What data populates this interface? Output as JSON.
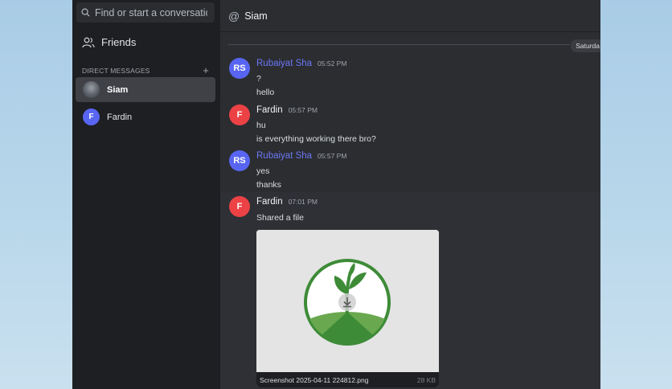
{
  "sidebar": {
    "search_placeholder": "Find or start a conversatic",
    "friends_label": "Friends",
    "dm_header": "DIRECT MESSAGES",
    "dm_add": "+",
    "dms": [
      {
        "name": "Siam",
        "avatar": "photo",
        "active": true
      },
      {
        "name": "Fardin",
        "avatar_initial": "F",
        "active": false
      }
    ]
  },
  "header": {
    "at_symbol": "@",
    "channel_name": "Siam"
  },
  "divider": {
    "label": "Saturda"
  },
  "messages": [
    {
      "initials": "RS",
      "author": "Rubaiyat Sha",
      "time": "05:52 PM",
      "lines": [
        "?",
        "hello"
      ]
    },
    {
      "initials": "F",
      "author": "Fardin",
      "time": "05:57 PM",
      "lines": [
        "hu",
        "is everything working there bro?"
      ]
    },
    {
      "initials": "RS",
      "author": "Rubaiyat Sha",
      "time": "05:57 PM",
      "lines": [
        "yes",
        "thanks"
      ]
    },
    {
      "initials": "F",
      "author": "Fardin",
      "time": "07:01 PM",
      "lines": [
        "Shared a file"
      ],
      "attachment": {
        "filename": "Screenshot 2025-04-11 224812.png",
        "size": "28 KB",
        "icon": "download-icon"
      }
    }
  ],
  "colors": {
    "sidebar_bg": "#1e1f22",
    "main_bg": "#2b2d31",
    "accent_blue": "#5865f2",
    "accent_red": "#ed4245",
    "logo_green": "#3d8b37"
  }
}
